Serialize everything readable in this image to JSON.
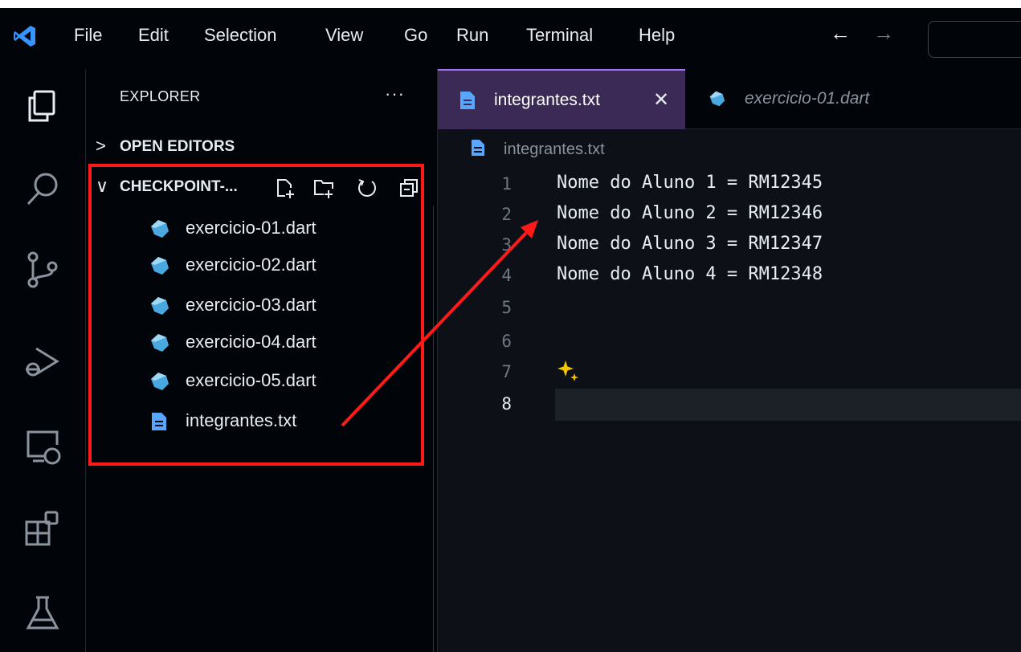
{
  "menu": {
    "items": [
      "File",
      "Edit",
      "Selection",
      "View",
      "Go",
      "Run",
      "Terminal",
      "Help"
    ],
    "back_arrow": "←",
    "forward_arrow": "→"
  },
  "activity_bar": {
    "icons": [
      "explorer-icon",
      "search-icon",
      "source-control-icon",
      "run-debug-icon",
      "remote-explorer-icon",
      "extensions-icon",
      "testing-icon"
    ]
  },
  "sidebar": {
    "title": "EXPLORER",
    "more": "···",
    "open_editors": {
      "chevron": ">",
      "label": "OPEN EDITORS"
    },
    "folder": {
      "chevron": "∨",
      "label": "CHECKPOINT-..."
    },
    "files": [
      {
        "name": "exercicio-01.dart",
        "icon": "dart-icon"
      },
      {
        "name": "exercicio-02.dart",
        "icon": "dart-icon"
      },
      {
        "name": "exercicio-03.dart",
        "icon": "dart-icon"
      },
      {
        "name": "exercicio-04.dart",
        "icon": "dart-icon"
      },
      {
        "name": "exercicio-05.dart",
        "icon": "dart-icon"
      },
      {
        "name": "integrantes.txt",
        "icon": "text-file-icon"
      }
    ]
  },
  "tabs": [
    {
      "label": "integrantes.txt",
      "active": true,
      "close": "✕"
    },
    {
      "label": "exercicio-01.dart",
      "active": false,
      "preview": true
    }
  ],
  "breadcrumb": {
    "file": "integrantes.txt"
  },
  "editor": {
    "line_numbers": [
      "1",
      "2",
      "3",
      "4",
      "5",
      "6",
      "7",
      "8"
    ],
    "lines": [
      "Nome do Aluno 1 = RM12345",
      "Nome do Aluno 2 = RM12346",
      "Nome do Aluno 3 = RM12347",
      "Nome do Aluno 4 = RM12348",
      "",
      "",
      "",
      ""
    ],
    "active_line": "8"
  },
  "colors": {
    "annotation": "#ff1a1a",
    "accent": "#a371f7",
    "dart": "#4aa8e0",
    "text_file": "#58a6ff",
    "sparkle": "#f2c500"
  }
}
